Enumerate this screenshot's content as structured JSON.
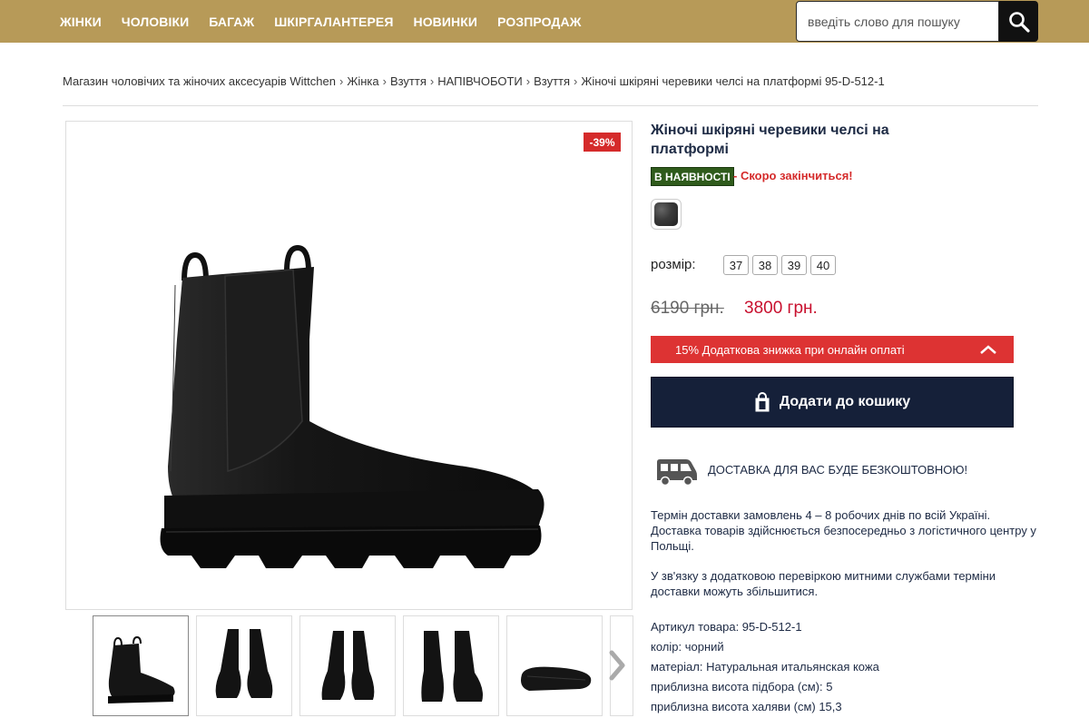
{
  "nav": {
    "items": [
      "ЖІНКИ",
      "ЧОЛОВІКИ",
      "БАГАЖ",
      "ШКІРГАЛАНТЕРЕЯ",
      "НОВИНКИ",
      "РОЗПРОДАЖ"
    ]
  },
  "search": {
    "placeholder": "введіть слово для пошуку",
    "icon": "search-icon"
  },
  "breadcrumb": [
    "Магазин чоловічих та жіночих аксесуарів Wittchen",
    "Жінка",
    "Взуття",
    "НАПІВЧОБОТИ",
    "Взуття",
    "Жіночі шкіряні черевики челсі на платформі 95-D-512-1"
  ],
  "product": {
    "discount_badge": "-39%",
    "title": "Жіночі шкіряні черевики челсі на платформі",
    "stock_badge": "В НАЯВНОСТІ",
    "stock_note": "- Скоро закінчиться!",
    "size_label": "розмір:",
    "sizes": [
      "37",
      "38",
      "39",
      "40"
    ],
    "old_price": "6190 грн.",
    "new_price": "3800 грн.",
    "promo": "15% Додаткова знижка при онлайн оплаті",
    "cart_button": "Додати до кошику",
    "delivery_title": "ДОСТАВКА ДЛЯ ВАС БУДЕ БЕЗКОШТОВНОЮ!",
    "delivery_text_1": "Термін доставки замовлень 4 – 8 робочих днів по всій Україні. Доставка товарів здійснюється безпосередньо з логістичного центру у Польщі.",
    "delivery_text_2": "У зв'язку з додатковою перевіркою митними службами терміни доставки можуть збільшитися.",
    "specs": [
      "Артикул товара: 95-D-512-1",
      "колір: чорний",
      "матеріал: Натуральная итальянская кожа",
      "приблизна висота підбора (см): 5",
      "приблизна висота халяви (см) 15,3"
    ]
  },
  "colors": {
    "topbar": "#b79a58",
    "badge_red": "#d52b2b",
    "stock_green": "#2f5b1c",
    "cart_navy": "#152039",
    "price_red": "#c8102e"
  }
}
